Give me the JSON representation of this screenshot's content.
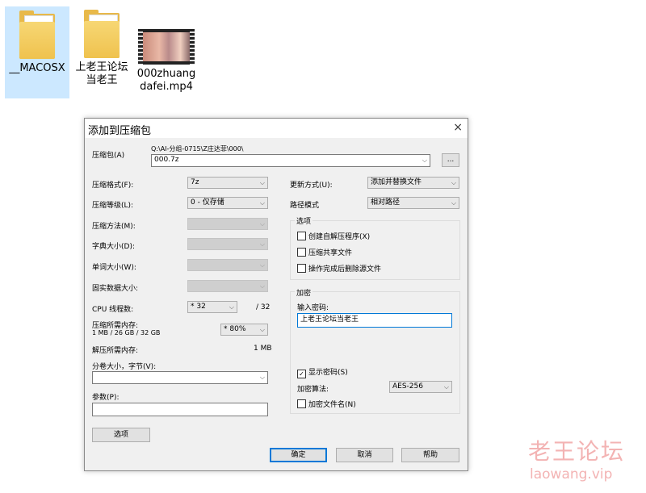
{
  "desktop": {
    "icons": [
      {
        "label": "__MACOSX",
        "type": "folder",
        "selected": true
      },
      {
        "label": "上老王论坛当老王",
        "type": "folder",
        "selected": false
      },
      {
        "label": "000zhuangdafei.mp4",
        "type": "video",
        "selected": false
      }
    ]
  },
  "dialog": {
    "title": "添加到压缩包",
    "close_icon": "×",
    "archive": {
      "label": "压缩包(A)",
      "path": "Q:\\AI-分组-0715\\Z庄达菲\\000\\",
      "value": "000.7z",
      "browse_label": "..."
    },
    "left": {
      "format": {
        "label": "压缩格式(F):",
        "value": "7z"
      },
      "level": {
        "label": "压缩等级(L):",
        "value": "0 - 仅存储"
      },
      "method": {
        "label": "压缩方法(M):",
        "value": ""
      },
      "dict": {
        "label": "字典大小(D):",
        "value": ""
      },
      "word": {
        "label": "单词大小(W):",
        "value": ""
      },
      "solid": {
        "label": "固实数据大小:",
        "value": ""
      },
      "cpu": {
        "label": "CPU 线程数:",
        "value": "* 32",
        "max": "/ 32"
      },
      "mem_compress": {
        "label": "压缩所需内存:",
        "detail": "1 MB / 26 GB / 32 GB",
        "value": "* 80%"
      },
      "mem_decompress": {
        "label": "解压所需内存:",
        "value": "1 MB"
      },
      "split": {
        "label": "分卷大小，字节(V):",
        "value": ""
      },
      "params": {
        "label": "参数(P):",
        "value": ""
      },
      "options_button": "选项"
    },
    "right": {
      "update": {
        "label": "更新方式(U):",
        "value": "添加并替换文件"
      },
      "path_mode": {
        "label": "路径模式",
        "value": "相对路径"
      },
      "options_group": {
        "title": "选项",
        "items": [
          {
            "label": "创建自解压程序(X)",
            "checked": false
          },
          {
            "label": "压缩共享文件",
            "checked": false
          },
          {
            "label": "操作完成后删除源文件",
            "checked": false
          }
        ]
      },
      "encryption_group": {
        "title": "加密",
        "password_label": "输入密码:",
        "password_value": "上老王论坛当老王",
        "show_password": {
          "label": "显示密码(S)",
          "checked": true
        },
        "method_label": "加密算法:",
        "method_value": "AES-256",
        "encrypt_names": {
          "label": "加密文件名(N)",
          "checked": false
        }
      }
    },
    "buttons": {
      "ok": "确定",
      "cancel": "取消",
      "help": "帮助"
    }
  },
  "watermark": {
    "line1": "老王论坛",
    "line2": "laowang.vip"
  }
}
